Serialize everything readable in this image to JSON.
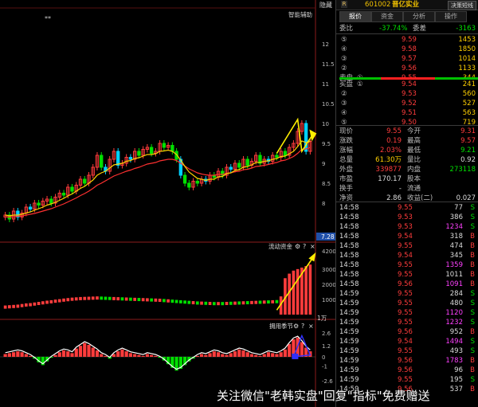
{
  "header": {
    "r_badge": "R",
    "code": "601002",
    "name": "晋亿实业",
    "btn": "决策短线"
  },
  "tabs": [
    {
      "label": "报价",
      "active": true
    },
    {
      "label": "资金",
      "active": false
    },
    {
      "label": "分析",
      "active": false
    },
    {
      "label": "操作",
      "active": false
    }
  ],
  "left": {
    "hide_label": "隐藏",
    "smart_label": "智能辅助",
    "star_mark": "**",
    "price_badge": "7.28",
    "panel2_label": "流动资金",
    "panel3_label": "拥用季节",
    "panel_icons": [
      "⚙",
      "?",
      "×"
    ],
    "unit_label": "1万"
  },
  "summary_top": {
    "weibi": {
      "label": "委比",
      "value": "-37.74%",
      "label2": "委差",
      "value2": "-3163"
    }
  },
  "sell_orders": [
    {
      "lvl": "⑤",
      "price": "9.59",
      "vol": "1453"
    },
    {
      "lvl": "④",
      "price": "9.58",
      "vol": "1850"
    },
    {
      "lvl": "③",
      "price": "9.57",
      "vol": "1014"
    },
    {
      "lvl": "②",
      "price": "9.56",
      "vol": "1133"
    },
    {
      "lvl": "①",
      "price": "9.55",
      "vol": "344",
      "label": "卖盘"
    }
  ],
  "buy_orders": [
    {
      "lvl": "①",
      "price": "9.54",
      "vol": "241",
      "label": "买盘"
    },
    {
      "lvl": "②",
      "price": "9.53",
      "vol": "560"
    },
    {
      "lvl": "③",
      "price": "9.52",
      "vol": "527"
    },
    {
      "lvl": "④",
      "price": "9.51",
      "vol": "563"
    },
    {
      "lvl": "⑤",
      "price": "9.50",
      "vol": "719"
    }
  ],
  "stats": [
    {
      "l1": "现价",
      "v1": "9.55",
      "c1": "red",
      "l2": "今开",
      "v2": "9.31",
      "c2": "red"
    },
    {
      "l1": "涨跌",
      "v1": "0.19",
      "c1": "red",
      "l2": "最高",
      "v2": "9.57",
      "c2": "red"
    },
    {
      "l1": "涨幅",
      "v1": "2.03%",
      "c1": "red",
      "l2": "最低",
      "v2": "9.21",
      "c2": "grn"
    },
    {
      "l1": "总量",
      "v1": "61.30万",
      "c1": "yel",
      "l2": "量比",
      "v2": "0.92",
      "c2": "wht"
    },
    {
      "l1": "外盘",
      "v1": "339877",
      "c1": "red",
      "l2": "内盘",
      "v2": "273118",
      "c2": "grn"
    },
    {
      "l1": "市盈",
      "v1": "170.17",
      "c1": "wht",
      "l2": "股本",
      "v2": "",
      "c2": "wht"
    },
    {
      "l1": "换手",
      "v1": "-",
      "c1": "wht",
      "l2": "流通",
      "v2": "",
      "c2": "wht"
    },
    {
      "l1": "净资",
      "v1": "2.86",
      "c1": "wht",
      "l2": "收益(二)",
      "v2": "0.027",
      "c2": "wht"
    }
  ],
  "ticks": [
    {
      "t": "14:58",
      "p": "9.55",
      "v": "77",
      "s": "S",
      "vc": "wht"
    },
    {
      "t": "14:58",
      "p": "9.53",
      "v": "386",
      "s": "S",
      "vc": "wht"
    },
    {
      "t": "14:58",
      "p": "9.53",
      "v": "1234",
      "s": "S",
      "vc": "mag"
    },
    {
      "t": "14:58",
      "p": "9.54",
      "v": "318",
      "s": "B",
      "vc": "wht"
    },
    {
      "t": "14:58",
      "p": "9.55",
      "v": "474",
      "s": "B",
      "vc": "wht"
    },
    {
      "t": "14:58",
      "p": "9.54",
      "v": "345",
      "s": "B",
      "vc": "wht"
    },
    {
      "t": "14:58",
      "p": "9.55",
      "v": "1359",
      "s": "B",
      "vc": "mag"
    },
    {
      "t": "14:58",
      "p": "9.55",
      "v": "1011",
      "s": "B",
      "vc": "wht"
    },
    {
      "t": "14:58",
      "p": "9.56",
      "v": "1091",
      "s": "B",
      "vc": "mag"
    },
    {
      "t": "14:59",
      "p": "9.55",
      "v": "284",
      "s": "S",
      "vc": "wht"
    },
    {
      "t": "14:59",
      "p": "9.55",
      "v": "480",
      "s": "S",
      "vc": "wht"
    },
    {
      "t": "14:59",
      "p": "9.55",
      "v": "1120",
      "s": "S",
      "vc": "mag"
    },
    {
      "t": "14:59",
      "p": "9.55",
      "v": "1232",
      "s": "S",
      "vc": "mag"
    },
    {
      "t": "14:59",
      "p": "9.56",
      "v": "952",
      "s": "B",
      "vc": "wht"
    },
    {
      "t": "14:59",
      "p": "9.54",
      "v": "1494",
      "s": "S",
      "vc": "mag"
    },
    {
      "t": "14:59",
      "p": "9.55",
      "v": "493",
      "s": "S",
      "vc": "wht"
    },
    {
      "t": "14:59",
      "p": "9.56",
      "v": "1783",
      "s": "B",
      "vc": "mag"
    },
    {
      "t": "14:59",
      "p": "9.56",
      "v": "96",
      "s": "B",
      "vc": "wht"
    },
    {
      "t": "14:59",
      "p": "9.55",
      "v": "195",
      "s": "S",
      "vc": "wht"
    },
    {
      "t": "14:59",
      "p": "9.56",
      "v": "537",
      "s": "B",
      "vc": "wht"
    }
  ],
  "watermark": "关注微信\"老韩实盘\"回复\"指标\"免费赠送",
  "colors": {
    "up": "#ff3c3c",
    "down": "#00e000",
    "ma_fast": "#ffd000",
    "ma_slow": "#ff3030",
    "arrow": "#ffee00",
    "band": "#3030ff"
  },
  "chart_data": [
    {
      "type": "candlestick",
      "ylim": [
        7.2,
        12.5
      ],
      "y_ticks": [
        12.0,
        11.5,
        11.0,
        10.5,
        10.0,
        9.5,
        9.0,
        8.5,
        8.0
      ],
      "close": [
        7.7,
        7.6,
        7.8,
        7.65,
        7.75,
        7.9,
        7.85,
        8.0,
        7.95,
        8.05,
        8.1,
        8.0,
        8.15,
        8.25,
        8.2,
        8.4,
        8.3,
        8.45,
        8.6,
        8.5,
        8.7,
        8.9,
        9.2,
        8.9,
        8.8,
        9.1,
        9.3,
        8.95,
        9.0,
        9.15,
        9.1,
        9.3,
        9.2,
        9.35,
        9.4,
        9.25,
        9.3,
        9.5,
        9.4,
        9.45,
        9.3,
        9.1,
        8.7,
        8.5,
        8.4,
        8.55,
        8.5,
        8.6,
        8.55,
        8.7,
        8.65,
        8.8,
        8.7,
        8.9,
        8.85,
        9.0,
        8.9,
        9.1,
        8.95,
        9.05,
        9.2,
        9.0,
        9.1,
        9.05,
        9.2,
        9.15,
        9.3,
        9.2,
        9.4,
        9.5,
        9.8,
        10.0,
        9.3,
        9.55
      ],
      "ma_fast": [
        7.7,
        7.68,
        7.7,
        7.7,
        7.72,
        7.75,
        7.78,
        7.82,
        7.86,
        7.9,
        7.95,
        7.98,
        8.02,
        8.07,
        8.12,
        8.18,
        8.23,
        8.3,
        8.37,
        8.42,
        8.5,
        8.58,
        8.7,
        8.76,
        8.8,
        8.88,
        8.96,
        8.98,
        9.0,
        9.05,
        9.07,
        9.12,
        9.14,
        9.18,
        9.22,
        9.22,
        9.24,
        9.3,
        9.31,
        9.33,
        9.3,
        9.22,
        9.08,
        8.92,
        8.78,
        8.7,
        8.62,
        8.6,
        8.57,
        8.6,
        8.6,
        8.66,
        8.67,
        8.74,
        8.76,
        8.82,
        8.84,
        8.9,
        8.92,
        8.96,
        9.02,
        9.02,
        9.05,
        9.06,
        9.1,
        9.12,
        9.17,
        9.18,
        9.24,
        9.3,
        9.42,
        9.56,
        9.52,
        9.55
      ],
      "ma_slow": [
        7.65,
        7.65,
        7.66,
        7.67,
        7.68,
        7.7,
        7.72,
        7.74,
        7.77,
        7.8,
        7.83,
        7.86,
        7.9,
        7.94,
        7.98,
        8.03,
        8.08,
        8.13,
        8.19,
        8.24,
        8.3,
        8.37,
        8.45,
        8.5,
        8.56,
        8.62,
        8.68,
        8.72,
        8.76,
        8.8,
        8.83,
        8.87,
        8.9,
        8.94,
        8.98,
        9.0,
        9.02,
        9.06,
        9.08,
        9.1,
        9.1,
        9.07,
        9.0,
        8.93,
        8.86,
        8.81,
        8.76,
        8.73,
        8.71,
        8.7,
        8.7,
        8.72,
        8.72,
        8.75,
        8.76,
        8.79,
        8.8,
        8.84,
        8.85,
        8.88,
        8.92,
        8.93,
        8.95,
        8.97,
        9.0,
        9.02,
        9.06,
        9.08,
        9.12,
        9.17,
        9.25,
        9.35,
        9.36,
        9.4
      ]
    },
    {
      "type": "bar",
      "ylim": [
        0,
        4200
      ],
      "y_ticks": [
        4200,
        3000,
        2000,
        1000
      ],
      "values": [
        600,
        620,
        640,
        660,
        700,
        740,
        760,
        800,
        840,
        880,
        920,
        950,
        990,
        1020,
        1060,
        1090,
        1120,
        1140,
        1160,
        1170,
        1180,
        1190,
        1200,
        1190,
        1180,
        1170,
        1160,
        1150,
        1140,
        1130,
        1120,
        1110,
        1100,
        1090,
        1080,
        1070,
        1060,
        1050,
        1030,
        1010,
        990,
        970,
        950,
        930,
        910,
        890,
        870,
        860,
        850,
        840,
        830,
        830,
        830,
        840,
        850,
        860,
        870,
        880,
        890,
        900,
        910,
        920,
        930,
        940,
        950,
        960,
        1200,
        2400,
        2700,
        2900,
        3000,
        3100,
        3200,
        3300
      ],
      "signs": [
        1,
        1,
        1,
        1,
        1,
        1,
        1,
        1,
        1,
        1,
        1,
        1,
        1,
        1,
        1,
        1,
        1,
        1,
        1,
        1,
        1,
        1,
        1,
        -1,
        -1,
        -1,
        1,
        1,
        -1,
        1,
        -1,
        1,
        -1,
        1,
        1,
        -1,
        1,
        1,
        -1,
        1,
        -1,
        -1,
        -1,
        -1,
        -1,
        1,
        -1,
        1,
        -1,
        1,
        -1,
        1,
        -1,
        1,
        -1,
        1,
        -1,
        1,
        -1,
        1,
        1,
        -1,
        1,
        -1,
        1,
        -1,
        1,
        1,
        1,
        1,
        1,
        1,
        1,
        1
      ]
    },
    {
      "type": "bar",
      "ylim": [
        -2.6,
        2.6
      ],
      "y_ticks": [
        2.6,
        1.2,
        0.0,
        -1.0,
        -2.6
      ],
      "values": [
        0.3,
        0.4,
        0.5,
        0.6,
        0.5,
        0.3,
        0.1,
        -0.2,
        -0.6,
        -0.9,
        -0.5,
        -0.1,
        0.2,
        0.5,
        0.7,
        0.6,
        0.4,
        0.9,
        1.2,
        1.5,
        1.3,
        1.0,
        0.7,
        0.3,
        0.1,
        -0.2,
        0.3,
        0.6,
        0.8,
        0.6,
        0.4,
        0.3,
        0.2,
        0.1,
        0.3,
        0.2,
        0.1,
        -0.1,
        -0.4,
        -0.8,
        -1.2,
        -1.5,
        -1.3,
        -0.9,
        -0.5,
        -0.2,
        0.1,
        0.3,
        0.2,
        0.4,
        0.6,
        0.5,
        0.3,
        0.2,
        0.4,
        0.6,
        0.8,
        0.7,
        0.5,
        0.3,
        0.2,
        0.1,
        0.3,
        0.5,
        0.4,
        0.3,
        0.5,
        0.8,
        1.4,
        1.9,
        2.1,
        1.6,
        1.0,
        0.6
      ]
    }
  ]
}
